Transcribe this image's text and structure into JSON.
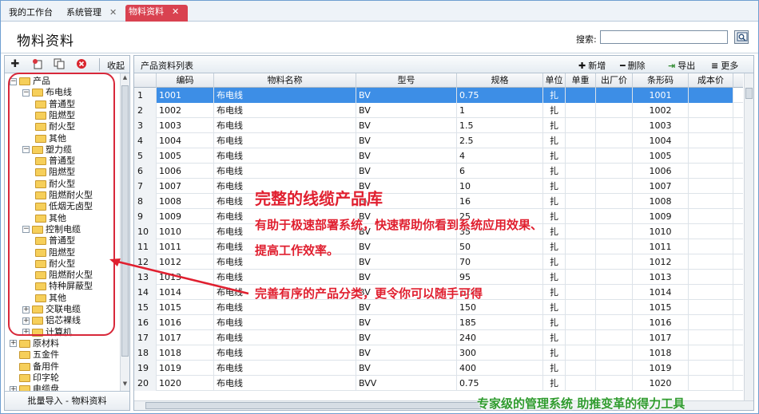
{
  "tabs": [
    {
      "label": "我的工作台",
      "closable": false
    },
    {
      "label": "系统管理",
      "closable": true
    },
    {
      "label": "物料资料",
      "closable": true,
      "active": true
    }
  ],
  "header": {
    "title": "物料资料",
    "search_label": "搜索:",
    "search_value": ""
  },
  "left": {
    "toolbar": {
      "collapse_label": "收起"
    },
    "tree": [
      {
        "label": "产品",
        "level": 0,
        "toggle": "−"
      },
      {
        "label": "布电线",
        "level": 1,
        "toggle": "−"
      },
      {
        "label": "普通型",
        "level": 2
      },
      {
        "label": "阻燃型",
        "level": 2
      },
      {
        "label": "耐火型",
        "level": 2
      },
      {
        "label": "其他",
        "level": 2
      },
      {
        "label": "塑力缆",
        "level": 1,
        "toggle": "−"
      },
      {
        "label": "普通型",
        "level": 2
      },
      {
        "label": "阻燃型",
        "level": 2
      },
      {
        "label": "耐火型",
        "level": 2
      },
      {
        "label": "阻燃耐火型",
        "level": 2
      },
      {
        "label": "低烟无卤型",
        "level": 2
      },
      {
        "label": "其他",
        "level": 2
      },
      {
        "label": "控制电缆",
        "level": 1,
        "toggle": "−"
      },
      {
        "label": "普通型",
        "level": 2
      },
      {
        "label": "阻燃型",
        "level": 2
      },
      {
        "label": "耐火型",
        "level": 2
      },
      {
        "label": "阻燃耐火型",
        "level": 2
      },
      {
        "label": "特种屏蔽型",
        "level": 2
      },
      {
        "label": "其他",
        "level": 2
      },
      {
        "label": "交联电缆",
        "level": 1,
        "toggle": "+"
      },
      {
        "label": "铝芯裸线",
        "level": 1,
        "toggle": "+"
      },
      {
        "label": "计算机",
        "level": 1,
        "toggle": "+"
      },
      {
        "label": "原材料",
        "level": 0,
        "toggle": "+"
      },
      {
        "label": "五金件",
        "level": 0
      },
      {
        "label": "备用件",
        "level": 0
      },
      {
        "label": "印字轮",
        "level": 0
      },
      {
        "label": "电缆盘",
        "level": 0,
        "toggle": "+"
      }
    ],
    "footer_label": "批量导入 - 物料资料"
  },
  "right": {
    "toolbar": {
      "title": "产品资料列表",
      "add_label": "新增",
      "delete_label": "删除",
      "export_label": "导出",
      "more_label": "更多"
    },
    "columns": [
      "",
      "编码",
      "物料名称",
      "型号",
      "规格",
      "单位",
      "单重",
      "出厂价",
      "条形码",
      "成本价"
    ],
    "rows": [
      [
        "1",
        "1001",
        "布电线",
        "BV",
        "0.75",
        "扎",
        "",
        "",
        "1001",
        ""
      ],
      [
        "2",
        "1002",
        "布电线",
        "BV",
        "1",
        "扎",
        "",
        "",
        "1002",
        ""
      ],
      [
        "3",
        "1003",
        "布电线",
        "BV",
        "1.5",
        "扎",
        "",
        "",
        "1003",
        ""
      ],
      [
        "4",
        "1004",
        "布电线",
        "BV",
        "2.5",
        "扎",
        "",
        "",
        "1004",
        ""
      ],
      [
        "5",
        "1005",
        "布电线",
        "BV",
        "4",
        "扎",
        "",
        "",
        "1005",
        ""
      ],
      [
        "6",
        "1006",
        "布电线",
        "BV",
        "6",
        "扎",
        "",
        "",
        "1006",
        ""
      ],
      [
        "7",
        "1007",
        "布电线",
        "BV",
        "10",
        "扎",
        "",
        "",
        "1007",
        ""
      ],
      [
        "8",
        "1008",
        "布电线",
        "BV",
        "16",
        "扎",
        "",
        "",
        "1008",
        ""
      ],
      [
        "9",
        "1009",
        "布电线",
        "BV",
        "25",
        "扎",
        "",
        "",
        "1009",
        ""
      ],
      [
        "10",
        "1010",
        "布电线",
        "BV",
        "35",
        "扎",
        "",
        "",
        "1010",
        ""
      ],
      [
        "11",
        "1011",
        "布电线",
        "BV",
        "50",
        "扎",
        "",
        "",
        "1011",
        ""
      ],
      [
        "12",
        "1012",
        "布电线",
        "BV",
        "70",
        "扎",
        "",
        "",
        "1012",
        ""
      ],
      [
        "13",
        "1013",
        "布电线",
        "BV",
        "95",
        "扎",
        "",
        "",
        "1013",
        ""
      ],
      [
        "14",
        "1014",
        "布电线",
        "BV",
        "120",
        "扎",
        "",
        "",
        "1014",
        ""
      ],
      [
        "15",
        "1015",
        "布电线",
        "BV",
        "150",
        "扎",
        "",
        "",
        "1015",
        ""
      ],
      [
        "16",
        "1016",
        "布电线",
        "BV",
        "185",
        "扎",
        "",
        "",
        "1016",
        ""
      ],
      [
        "17",
        "1017",
        "布电线",
        "BV",
        "240",
        "扎",
        "",
        "",
        "1017",
        ""
      ],
      [
        "18",
        "1018",
        "布电线",
        "BV",
        "300",
        "扎",
        "",
        "",
        "1018",
        ""
      ],
      [
        "19",
        "1019",
        "布电线",
        "BV",
        "400",
        "扎",
        "",
        "",
        "1019",
        ""
      ],
      [
        "20",
        "1020",
        "布电线",
        "BVV",
        "0.75",
        "扎",
        "",
        "",
        "1020",
        ""
      ]
    ]
  },
  "overlay": {
    "title": "完整的线缆产品库",
    "line1": "有助于极速部署系统，快速帮助你看到系统应用效果、",
    "line2": "提高工作效率。",
    "line3": "完善有序的产品分类，更令你可以随手可得",
    "slogan": "专家级的管理系统  助推变革的得力工具",
    "accent_color": "#e01f2f",
    "slogan_color": "#2f9b2e"
  }
}
